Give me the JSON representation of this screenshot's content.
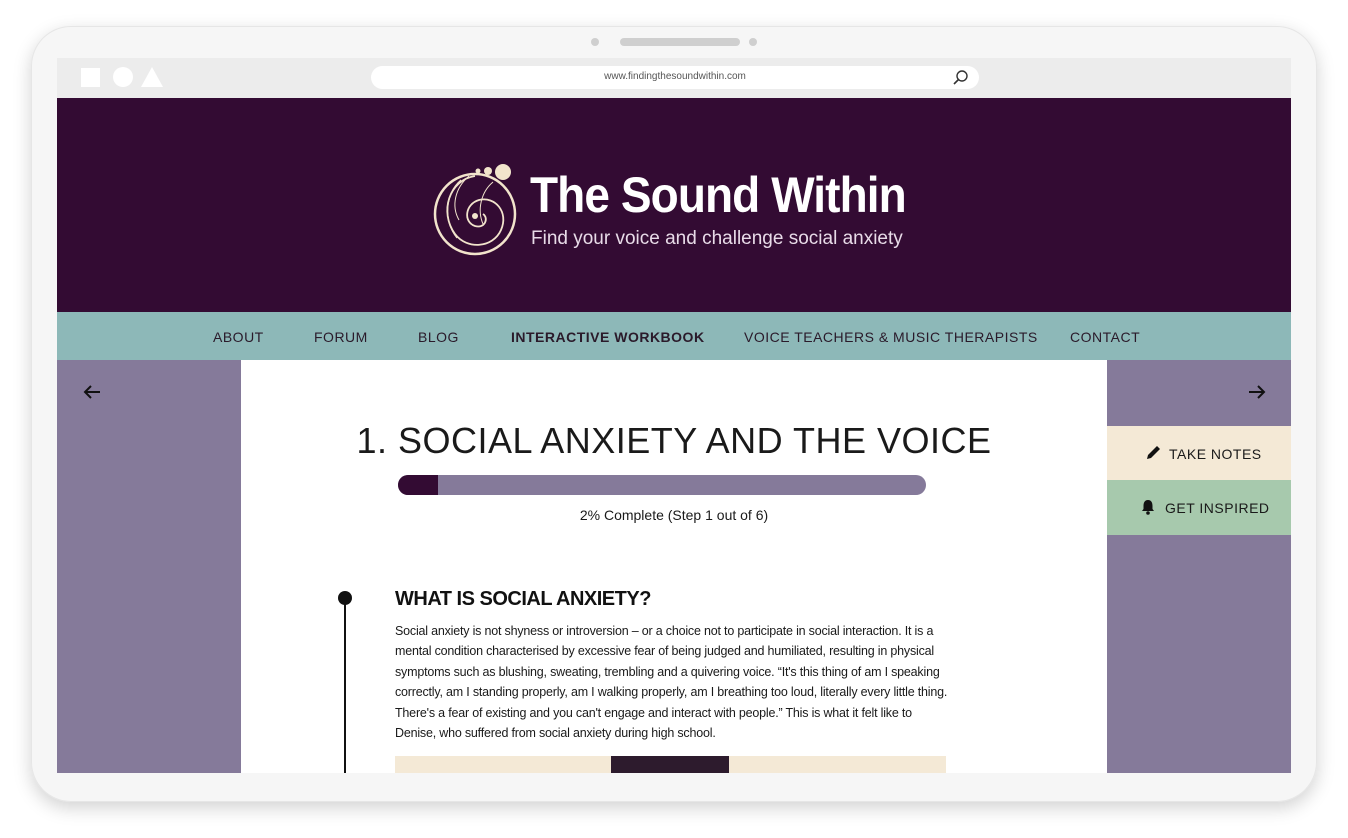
{
  "browser": {
    "url": "www.findingthesoundwithin.com"
  },
  "site": {
    "title": "The Sound Within",
    "subtitle": "Find your voice and challenge social anxiety"
  },
  "nav": {
    "items": [
      {
        "label": "ABOUT"
      },
      {
        "label": "FORUM"
      },
      {
        "label": "BLOG"
      },
      {
        "label": "INTERACTIVE WORKBOOK"
      },
      {
        "label": "VOICE TEACHERS & MUSIC THERAPISTS"
      },
      {
        "label": "CONTACT"
      }
    ],
    "active": "INTERACTIVE WORKBOOK"
  },
  "chapter": {
    "title": "1. SOCIAL ANXIETY AND THE VOICE",
    "progress_fraction": 0.076,
    "progress_text": "2% Complete (Step 1 out of 6)"
  },
  "section": {
    "heading": "WHAT IS SOCIAL ANXIETY?",
    "body": "Social anxiety is not shyness or introversion – or a choice not to participate in social interaction. It is a mental condition characterised by excessive fear of being judged and humiliated, resulting in physical symptoms such as blushing, sweating, trembling and a quivering voice. “It's this thing of am I speaking correctly, am I standing properly, am I walking properly, am I breathing too loud, literally every little thing. There's a fear of existing and you can't engage and interact with people.” This is what it felt like to Denise, who suffered from social anxiety during high school."
  },
  "side_tabs": {
    "notes_label": "TAKE NOTES",
    "inspired_label": "GET INSPIRED"
  },
  "icons": {
    "prev": "arrow-left-icon",
    "next": "arrow-right-icon",
    "notes": "pen-icon",
    "inspired": "bell-icon",
    "search": "search-icon"
  },
  "colors": {
    "hero_bg": "#330b33",
    "nav_bg": "#8db8b8",
    "side_bg": "#857a9a",
    "notes_bg": "#f4e9d6",
    "inspired_bg": "#a7c9ad"
  }
}
